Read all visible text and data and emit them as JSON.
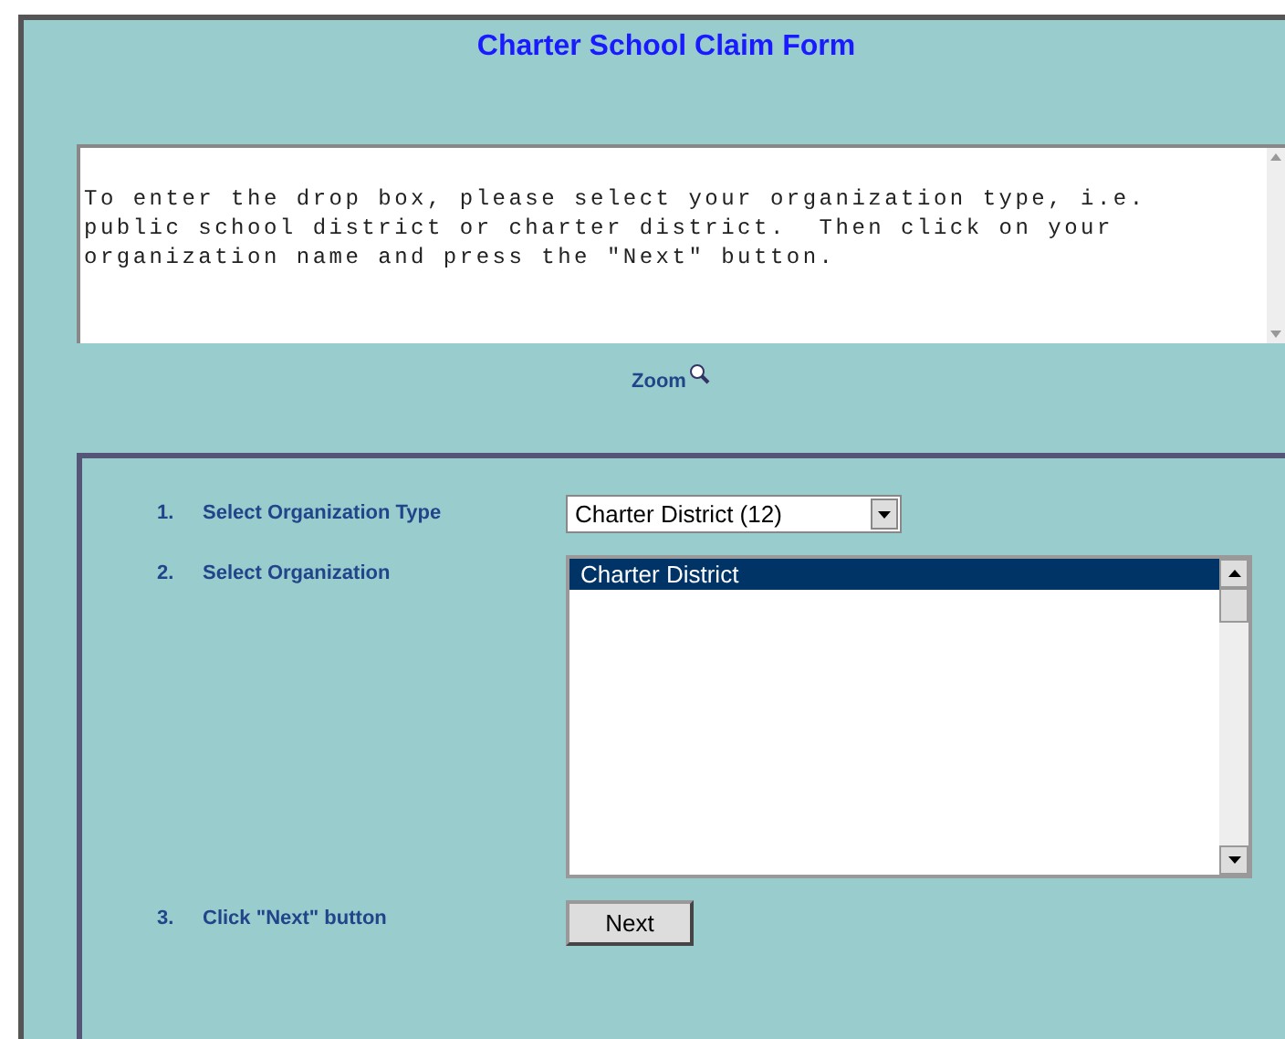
{
  "title": "Charter School Claim Form",
  "instructions": "To enter the drop box, please select your organization type, i.e. public school district or charter district.  Then click on your organization name and press the \"Next\" button.",
  "zoom_link": "Zoom",
  "steps": [
    {
      "number": "1.",
      "label": "Select Organization Type",
      "kind": "dropdown"
    },
    {
      "number": "2.",
      "label": "Select Organization",
      "kind": "listbox"
    },
    {
      "number": "3.",
      "label": "Click \"Next\" button",
      "kind": "button"
    }
  ],
  "organization_type": {
    "value": "Charter District (12)"
  },
  "organizations": [
    {
      "label": "Charter District",
      "selected": true
    }
  ],
  "next_button": "Next"
}
